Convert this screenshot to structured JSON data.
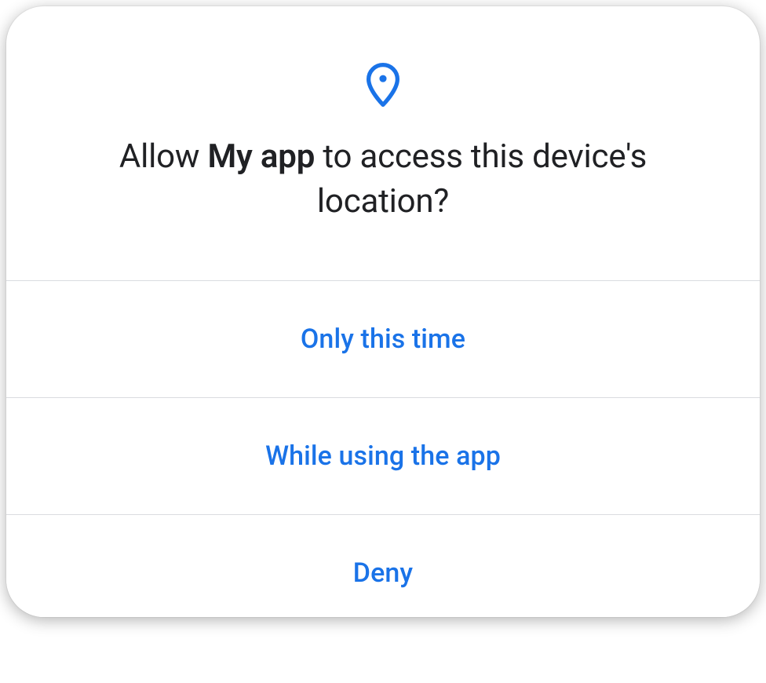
{
  "colors": {
    "accent": "#1a73e8",
    "text": "#202124",
    "divider": "#dadce0"
  },
  "dialog": {
    "icon": "location-pin",
    "title_prefix": "Allow ",
    "app_name": "My app",
    "title_suffix": " to access this device's location?",
    "options": [
      {
        "label": "Only this time"
      },
      {
        "label": "While using the app"
      },
      {
        "label": "Deny"
      }
    ]
  }
}
